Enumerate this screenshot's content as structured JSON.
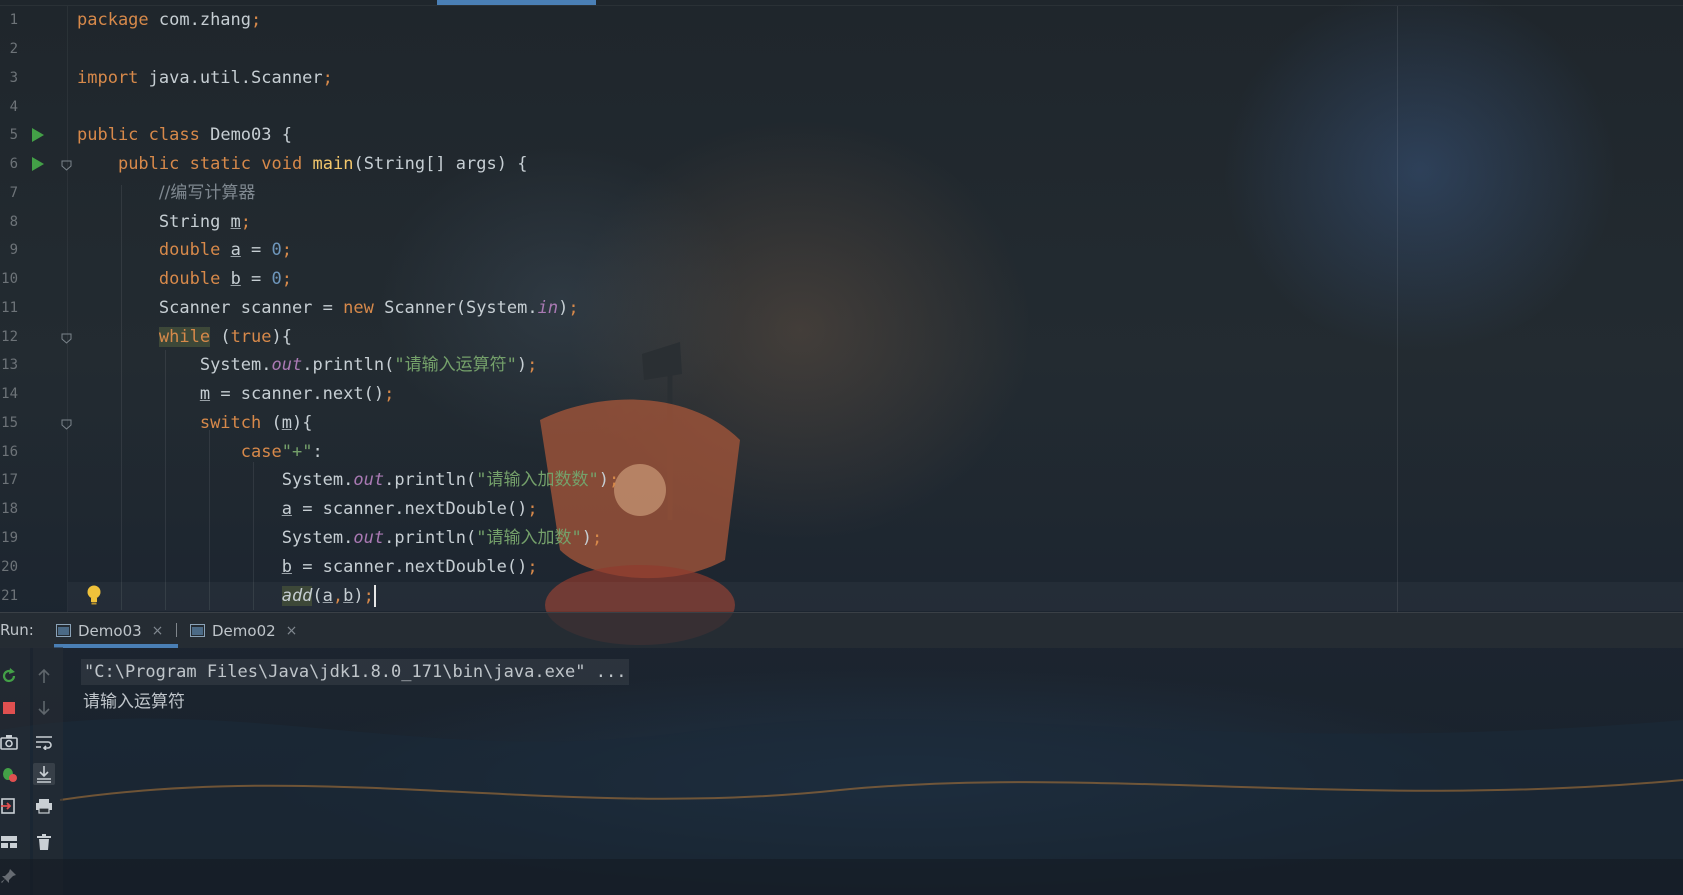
{
  "editor": {
    "line_numbers": [
      "1",
      "2",
      "3",
      "4",
      "5",
      "6",
      "7",
      "8",
      "9",
      "10",
      "11",
      "12",
      "13",
      "14",
      "15",
      "16",
      "17",
      "18",
      "19",
      "20",
      "21"
    ],
    "code": {
      "l1": {
        "kw": "package",
        "rest": " com.zhang",
        "semi": ";"
      },
      "l3": {
        "kw": "import",
        "rest": " java.util.Scanner",
        "semi": ";"
      },
      "l5": {
        "kw1": "public",
        "kw2": "class",
        "rest": " Demo03 {"
      },
      "l6": {
        "kw1": "public",
        "kw2": "static",
        "kw3": "void",
        "fn": "main",
        "rest": "(String[] args) {"
      },
      "l7": {
        "comment": "//编写计算器"
      },
      "l8": {
        "type": "String ",
        "var": "m",
        "semi": ";"
      },
      "l9": {
        "kw": "double",
        "var": "a",
        "op": " = ",
        "num": "0",
        "semi": ";"
      },
      "l10": {
        "kw": "double",
        "var": "b",
        "op": " = ",
        "num": "0",
        "semi": ";"
      },
      "l11": {
        "pre": "Scanner scanner = ",
        "kw": "new",
        "mid": " Scanner(System.",
        "field": "in",
        "post": ")",
        "semi": ";"
      },
      "l12": {
        "kw": "while",
        "mid": " (",
        "kw2": "true",
        "post": "){"
      },
      "l13": {
        "pre": "System.",
        "field": "out",
        "mid": ".println(",
        "str": "\"请输入运算符\"",
        "post": ")",
        "semi": ";"
      },
      "l14": {
        "var": "m",
        "rest": " = scanner.next()",
        "semi": ";"
      },
      "l15": {
        "kw": "switch",
        "mid": " (",
        "var": "m",
        "post": "){"
      },
      "l16": {
        "kw": "case",
        "str": "\"+\"",
        "post": ":"
      },
      "l17": {
        "pre": "System.",
        "field": "out",
        "mid": ".println(",
        "str": "\"请输入加数数\"",
        "post": ")",
        "semi": ";"
      },
      "l18": {
        "var": "a",
        "rest": " = scanner.nextDouble()",
        "semi": ";"
      },
      "l19": {
        "pre": "System.",
        "field": "out",
        "mid": ".println(",
        "str": "\"请输入加数\"",
        "post": ")",
        "semi": ";"
      },
      "l20": {
        "var": "b",
        "rest": " = scanner.nextDouble()",
        "semi": ";"
      },
      "l21": {
        "fn": "add",
        "p1": "(",
        "a": "a",
        "comma": ",",
        "b": "b",
        "p2": ")",
        "semi": ";"
      }
    }
  },
  "run": {
    "label": "Run:",
    "tabs": [
      {
        "label": "Demo03",
        "close": "×"
      },
      {
        "label": "Demo02",
        "close": "×"
      }
    ],
    "console": {
      "command": "\"C:\\Program Files\\Java\\jdk1.8.0_171\\bin\\java.exe\" ...",
      "output": "请输入运算符"
    }
  },
  "icons": [
    "run-icon",
    "stop-icon",
    "camera-icon",
    "debug-icon",
    "exit-icon",
    "layout-icon",
    "pin-icon",
    "up-arrow-icon",
    "down-arrow-icon",
    "soft-wrap-icon",
    "scroll-to-end-icon",
    "print-icon",
    "trash-icon",
    "bulb-icon",
    "console-tab-icon"
  ],
  "colors": {
    "keyword": "#d7894a",
    "string": "#74a06a",
    "number": "#6e96bb",
    "function": "#f2c66b",
    "field": "#a979b3",
    "accent": "#4a7fb5",
    "run_green": "#43a047",
    "stop_red": "#e05050"
  }
}
